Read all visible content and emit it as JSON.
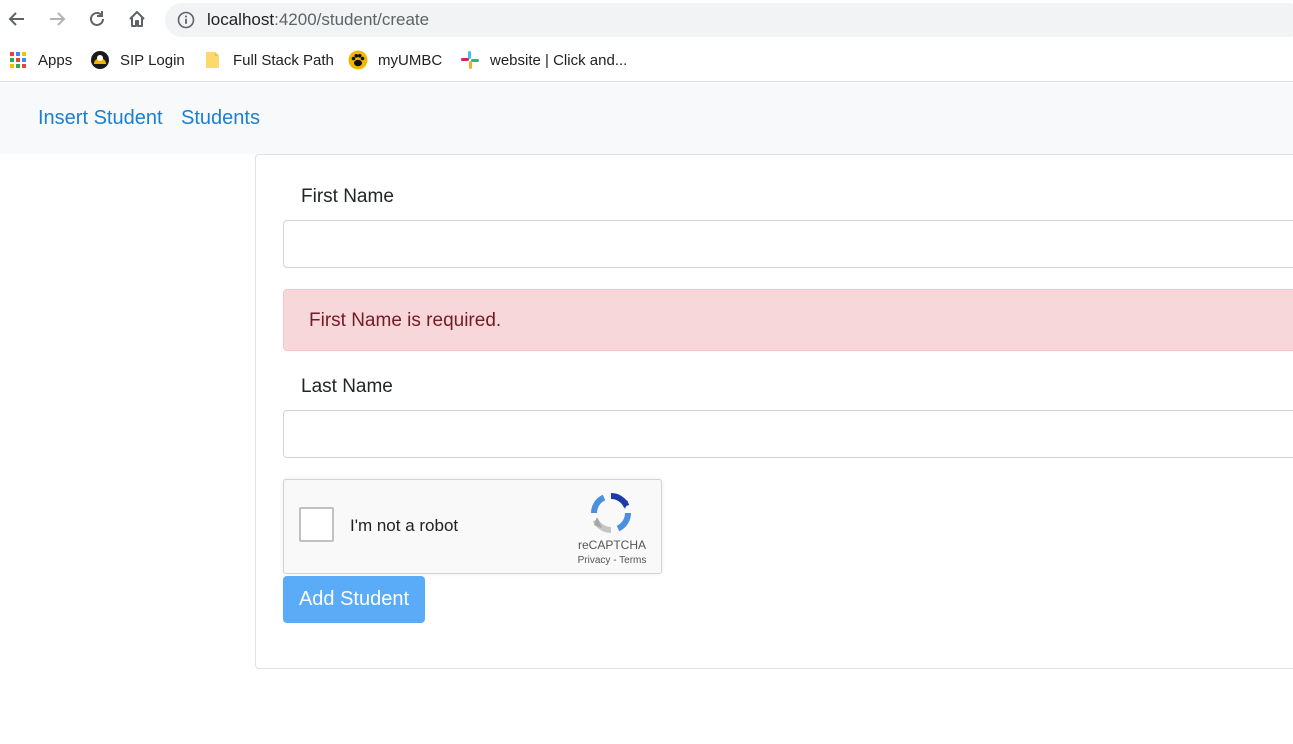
{
  "browser": {
    "url_host": "localhost",
    "url_path": ":4200/student/create",
    "icons": {
      "back": "back-arrow-icon",
      "forward": "forward-arrow-icon",
      "reload": "reload-icon",
      "home": "home-icon",
      "info": "info-icon"
    }
  },
  "bookmarks": [
    {
      "label": "Apps",
      "icon": "apps-grid-icon"
    },
    {
      "label": "SIP Login",
      "icon": "sip-login-icon"
    },
    {
      "label": "Full Stack Path",
      "icon": "folder-icon"
    },
    {
      "label": "myUMBC",
      "icon": "paw-icon"
    },
    {
      "label": "website | Click and...",
      "icon": "slack-icon"
    }
  ],
  "navbar": {
    "links": [
      "Insert Student",
      "Students"
    ],
    "link_color": "#1a7fd4"
  },
  "form": {
    "first_name_label": "First Name",
    "first_name_value": "",
    "error_message": "First Name is required.",
    "last_name_label": "Last Name",
    "last_name_value": "",
    "captcha": {
      "text": "I'm not a robot",
      "brand": "reCAPTCHA",
      "privacy": "Privacy",
      "separator": " - ",
      "terms": "Terms",
      "checked": false
    },
    "submit_label": "Add Student",
    "submit_color": "#5aabf8",
    "error_bg": "#f8d7da",
    "error_text_color": "#721c24"
  }
}
